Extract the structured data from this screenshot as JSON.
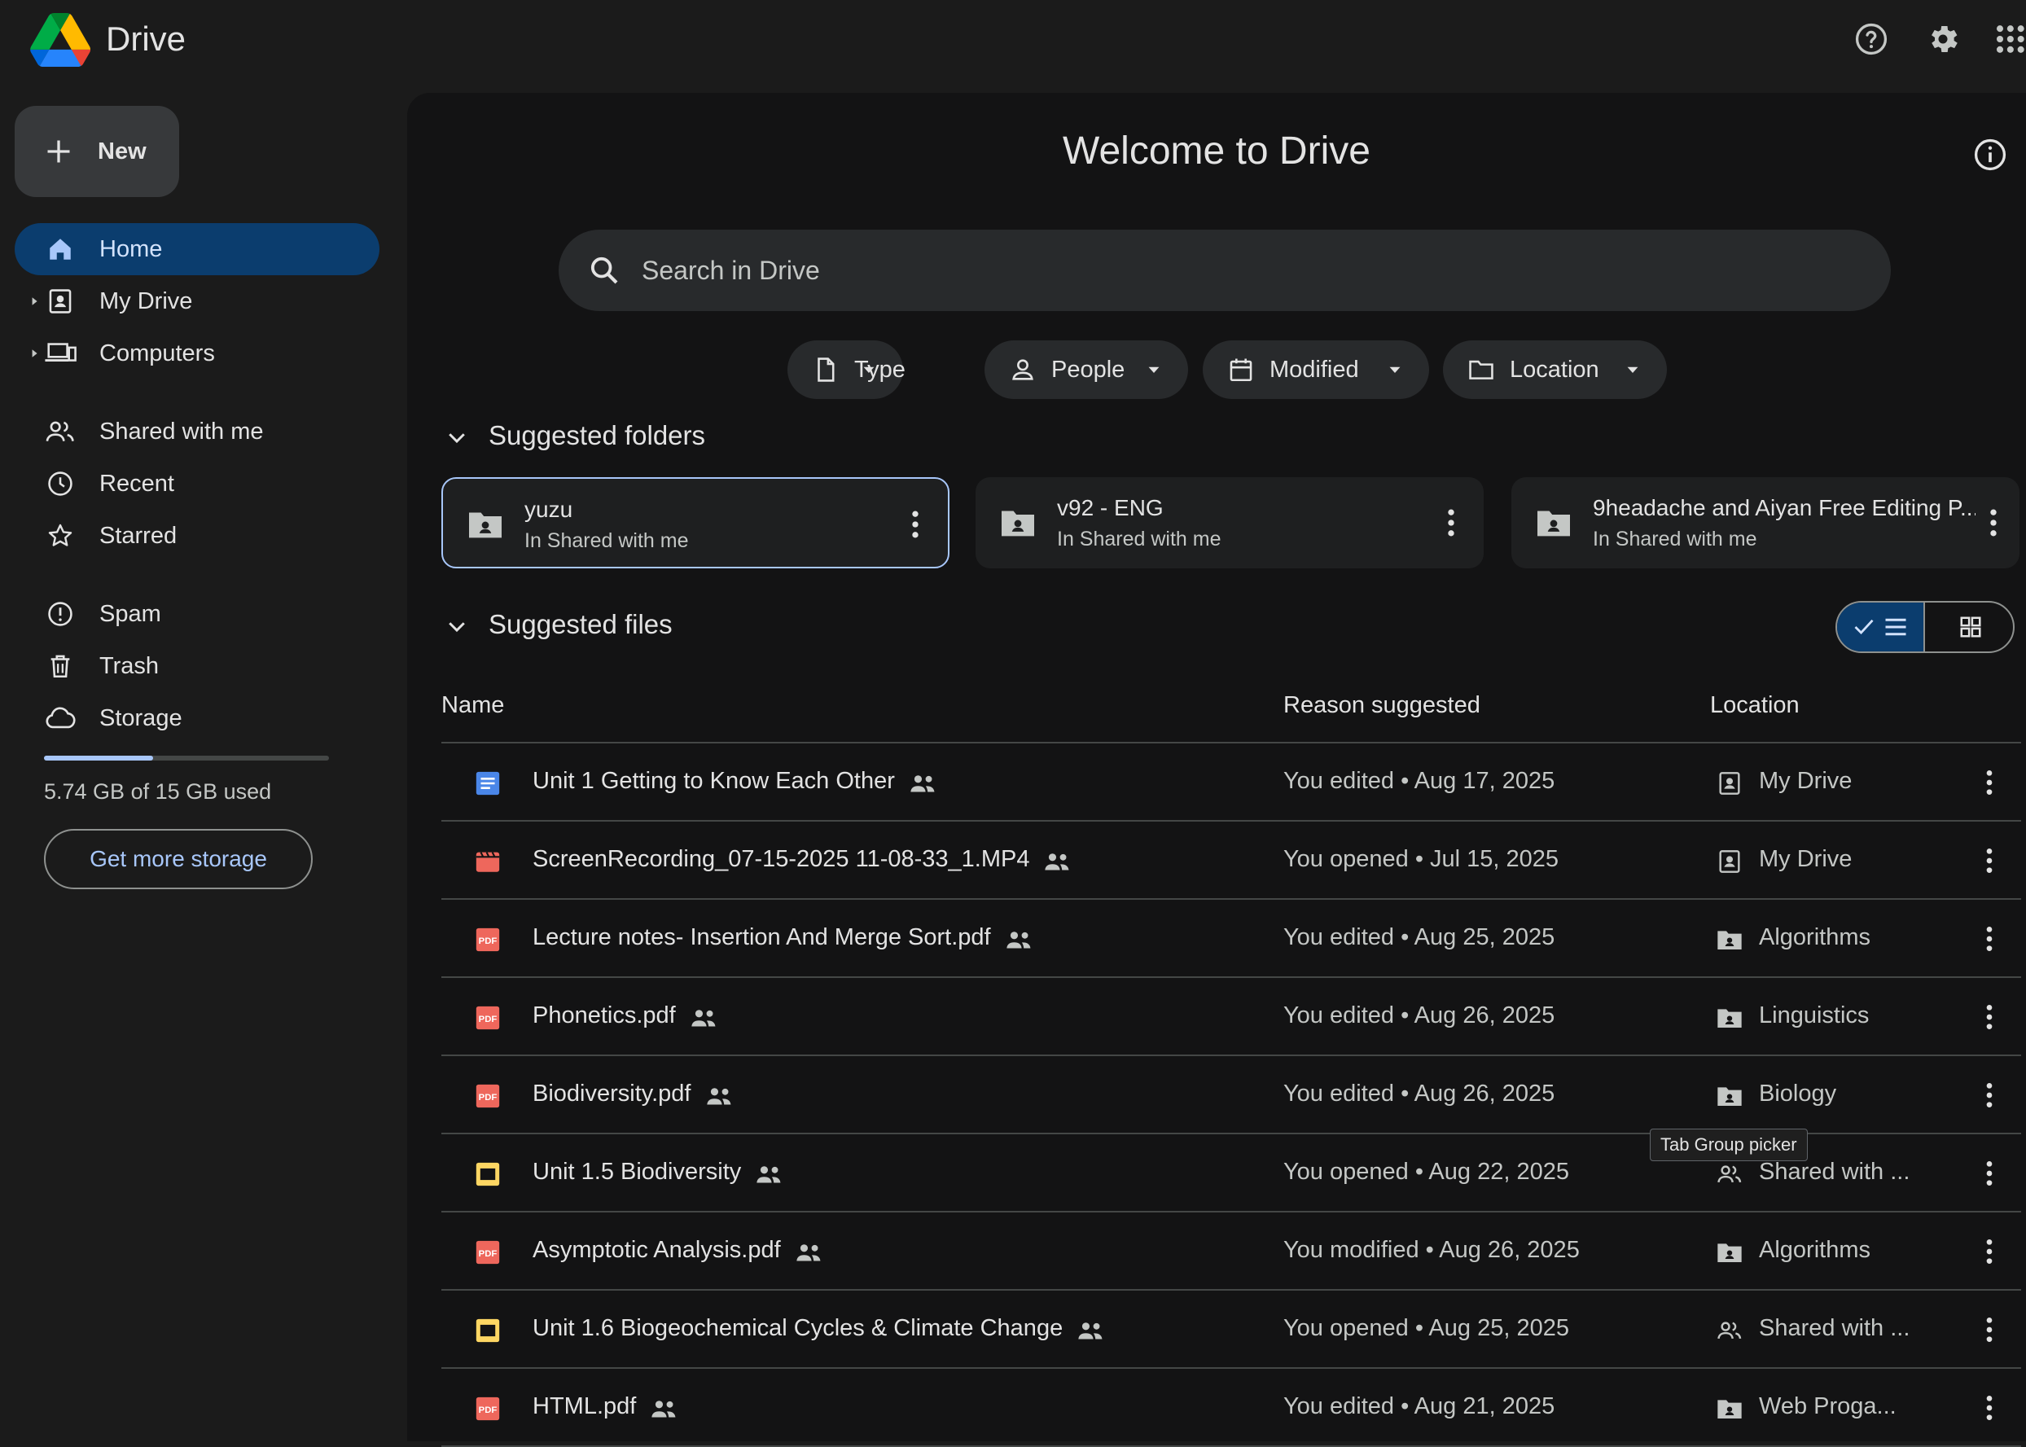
{
  "header": {
    "brand": "Drive",
    "help_icon": "help-circle-icon",
    "settings_icon": "gear-icon",
    "apps_icon": "apps-grid-icon"
  },
  "sidebar": {
    "new_label": "New",
    "items": [
      {
        "label": "Home",
        "icon": "home-icon",
        "active": true
      },
      {
        "label": "My Drive",
        "icon": "my-drive-icon",
        "expandable": true
      },
      {
        "label": "Computers",
        "icon": "computers-icon",
        "expandable": true
      },
      {
        "label": "Shared with me",
        "icon": "people-icon"
      },
      {
        "label": "Recent",
        "icon": "clock-icon"
      },
      {
        "label": "Starred",
        "icon": "star-icon"
      },
      {
        "label": "Spam",
        "icon": "spam-icon"
      },
      {
        "label": "Trash",
        "icon": "trash-icon"
      },
      {
        "label": "Storage",
        "icon": "cloud-icon"
      }
    ],
    "storage": {
      "used_fraction": 0.383,
      "text": "5.74 GB of 15 GB used",
      "button": "Get more storage"
    }
  },
  "main": {
    "title": "Welcome to Drive",
    "search_placeholder": "Search in Drive",
    "filters": [
      {
        "label": "Type",
        "icon": "file-icon"
      },
      {
        "label": "People",
        "icon": "person-icon"
      },
      {
        "label": "Modified",
        "icon": "calendar-icon"
      },
      {
        "label": "Location",
        "icon": "folder-icon"
      }
    ],
    "suggested_folders_title": "Suggested folders",
    "folders": [
      {
        "name": "yuzu",
        "sub": "In Shared with me",
        "selected": true
      },
      {
        "name": "v92 - ENG",
        "sub": "In Shared with me"
      },
      {
        "name": "9headache and Aiyan Free Editing P...",
        "sub": "In Shared with me"
      }
    ],
    "suggested_files_title": "Suggested files",
    "columns": {
      "name": "Name",
      "reason": "Reason suggested",
      "location": "Location"
    },
    "files": [
      {
        "name": "Unit 1 Getting to Know Each Other",
        "type": "doc",
        "reason": "You edited • Aug 17, 2025",
        "location": "My Drive",
        "loc_icon": "my-drive"
      },
      {
        "name": "ScreenRecording_07-15-2025 11-08-33_1.MP4",
        "type": "video",
        "reason": "You opened • Jul 15, 2025",
        "location": "My Drive",
        "loc_icon": "my-drive"
      },
      {
        "name": "Lecture notes- Insertion And Merge Sort.pdf",
        "type": "pdf",
        "reason": "You edited • Aug 25, 2025",
        "location": "Algorithms",
        "loc_icon": "shared-folder"
      },
      {
        "name": "Phonetics.pdf",
        "type": "pdf",
        "reason": "You edited • Aug 26, 2025",
        "location": "Linguistics",
        "loc_icon": "shared-folder"
      },
      {
        "name": "Biodiversity.pdf",
        "type": "pdf",
        "reason": "You edited • Aug 26, 2025",
        "location": "Biology",
        "loc_icon": "shared-folder"
      },
      {
        "name": "Unit 1.5 Biodiversity",
        "type": "slides",
        "reason": "You opened • Aug 22, 2025",
        "location": "Shared with ...",
        "loc_icon": "people"
      },
      {
        "name": "Asymptotic Analysis.pdf",
        "type": "pdf",
        "reason": "You modified • Aug 26, 2025",
        "location": "Algorithms",
        "loc_icon": "shared-folder"
      },
      {
        "name": "Unit 1.6 Biogeochemical Cycles & Climate Change",
        "type": "slides",
        "reason": "You opened • Aug 25, 2025",
        "location": "Shared with ...",
        "loc_icon": "people"
      },
      {
        "name": "HTML.pdf",
        "type": "pdf",
        "reason": "You edited • Aug 21, 2025",
        "location": "Web Proga...",
        "loc_icon": "shared-folder"
      }
    ],
    "tooltip": "Tab Group picker"
  },
  "colors": {
    "background": "#1b1b1b",
    "panel": "#131314",
    "accent": "#a8c7fa",
    "active_nav": "#0b3d6e",
    "pdf": "#ee675c",
    "doc": "#4a86e8",
    "slides": "#fdd663"
  }
}
